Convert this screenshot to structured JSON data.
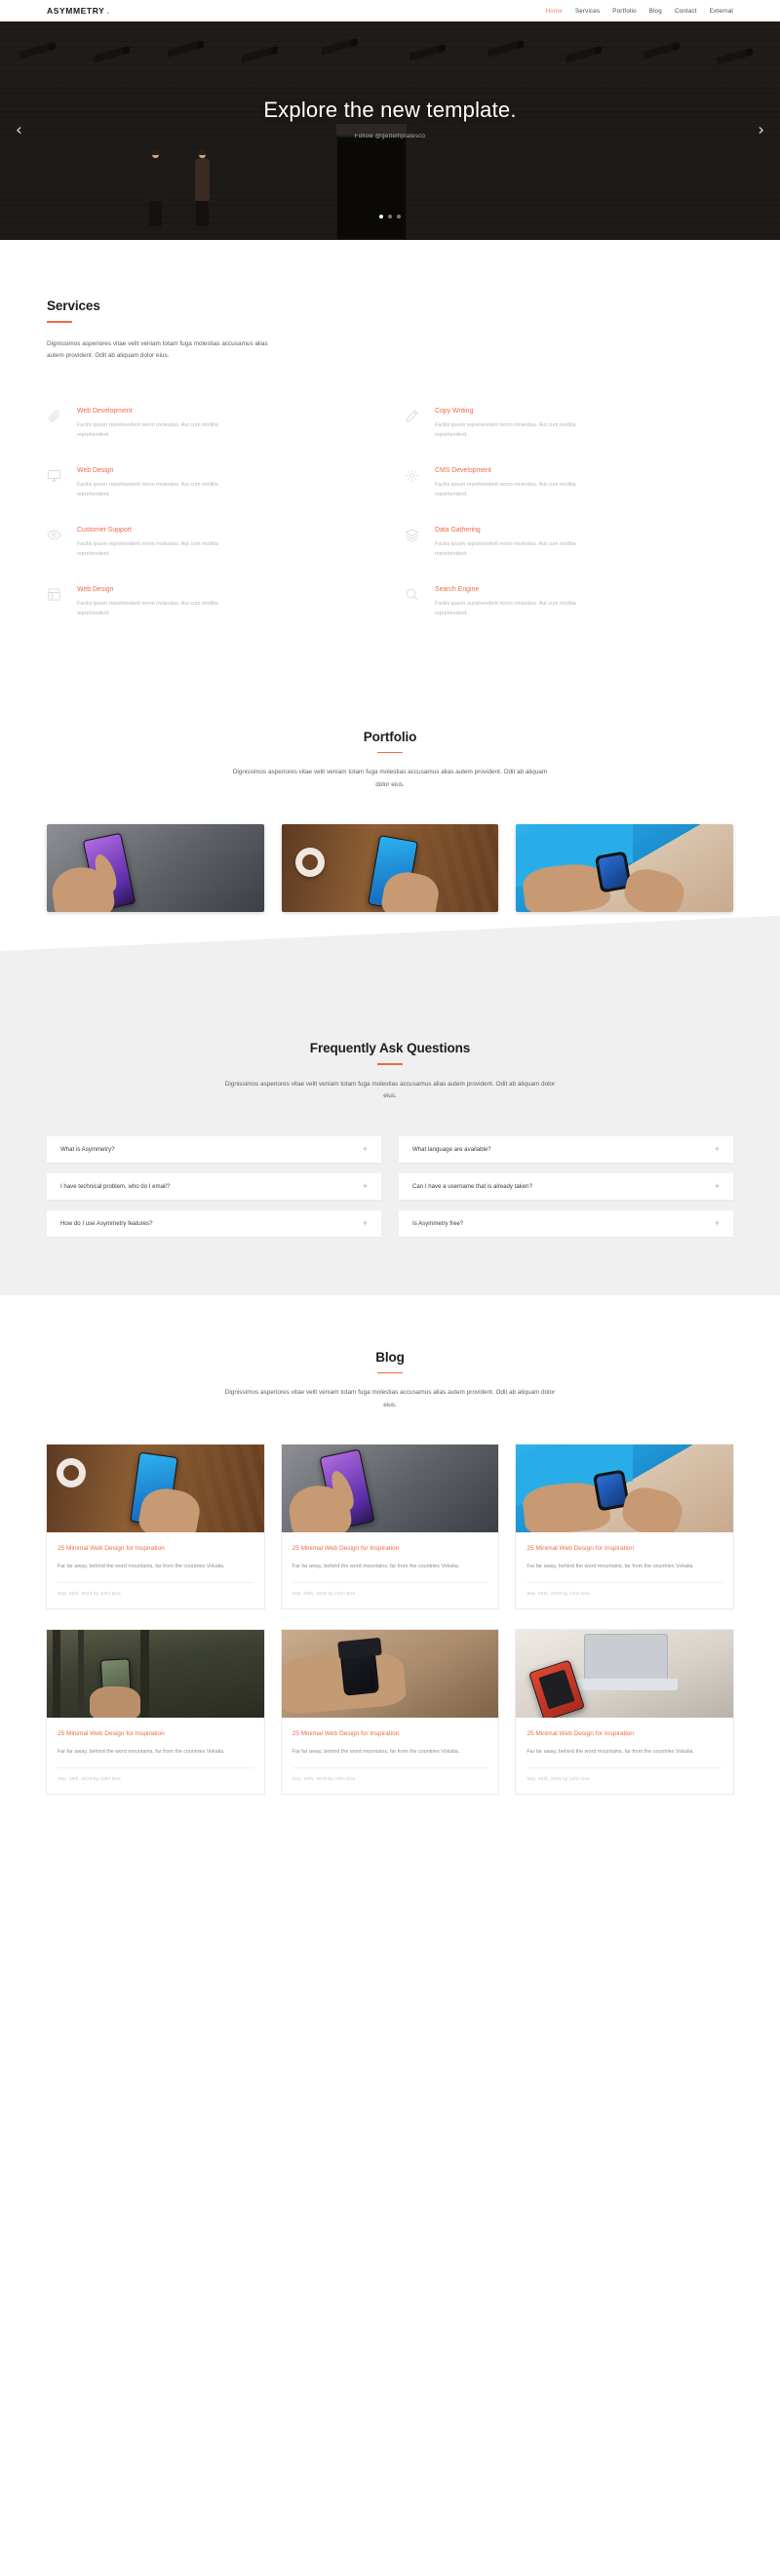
{
  "header": {
    "brand": "ASYMMETRY",
    "brand_dot": ".",
    "nav": [
      {
        "label": "Home",
        "active": true
      },
      {
        "label": "Services",
        "active": false
      },
      {
        "label": "Portfolio",
        "active": false
      },
      {
        "label": "Blog",
        "active": false
      },
      {
        "label": "Contact",
        "active": false
      },
      {
        "label": "External",
        "active": false
      }
    ]
  },
  "hero": {
    "title": "Explore the new template.",
    "subtitle": "Follow @gettemplatesco",
    "prev_icon": "‹",
    "next_icon": "›",
    "slides": 3,
    "active_slide": 1
  },
  "services": {
    "title": "Services",
    "description": "Dignissimos asperiores vitae velit veniam totam fuga molestias accusamus alias autem provident. Odit ab aliquam dolor eius.",
    "items": [
      {
        "icon": "paperclip-icon",
        "title": "Web Development",
        "desc": "Facilis ipsum reprehenderit nemo molestias. Aut cum mollitia reprehenderit."
      },
      {
        "icon": "pencil-icon",
        "title": "Copy Writing",
        "desc": "Facilis ipsum reprehenderit nemo molestias. Aut cum mollitia reprehenderit."
      },
      {
        "icon": "monitor-icon",
        "title": "Web Design",
        "desc": "Facilis ipsum reprehenderit nemo molestias. Aut cum mollitia reprehenderit."
      },
      {
        "icon": "gear-icon",
        "title": "CMS Development",
        "desc": "Facilis ipsum reprehenderit nemo molestias. Aut cum mollitia reprehenderit."
      },
      {
        "icon": "eye-icon",
        "title": "Customer Support",
        "desc": "Facilis ipsum reprehenderit nemo molestias. Aut cum mollitia reprehenderit."
      },
      {
        "icon": "layers-icon",
        "title": "Data Gathering",
        "desc": "Facilis ipsum reprehenderit nemo molestias. Aut cum mollitia reprehenderit."
      },
      {
        "icon": "layout-icon",
        "title": "Web Design",
        "desc": "Facilis ipsum reprehenderit nemo molestias. Aut cum mollitia reprehenderit."
      },
      {
        "icon": "search-icon",
        "title": "Search Engine",
        "desc": "Facilis ipsum reprehenderit nemo molestias. Aut cum mollitia reprehenderit."
      }
    ]
  },
  "portfolio": {
    "title": "Portfolio",
    "description": "Dignissimos asperiores vitae velit veniam totam fuga molestias accusamus alias autem provident. Odit ab aliquam dolor eius.",
    "items": [
      {
        "name": "portfolio-item-phone-purple"
      },
      {
        "name": "portfolio-item-phone-coffee"
      },
      {
        "name": "portfolio-item-smartwatch"
      }
    ]
  },
  "faq": {
    "title": "Frequently Ask Questions",
    "description": "Dignissimos asperiores vitae velit veniam totam fuga molestias accusamus alias autem provident. Odit ab aliquam dolor eius.",
    "plus_icon": "+",
    "items": [
      {
        "question": "What is Asymmetry?"
      },
      {
        "question": "What language are available?"
      },
      {
        "question": "I have technical problem, who do I email?"
      },
      {
        "question": "Can I have a username that is already taken?"
      },
      {
        "question": "How do I use Asymmetry features?"
      },
      {
        "question": "Is Asymmetry free?"
      }
    ]
  },
  "blog": {
    "title": "Blog",
    "description": "Dignissimos asperiores vitae velit veniam totam fuga molestias accusamus alias autem provident. Odit ab aliquam dolor eius.",
    "posts": [
      {
        "title": "25 Minimal Web Design for Inspiration",
        "excerpt": "Far far away, behind the word mountains, far from the countries Vokalia.",
        "meta": "Sep. 29th, 2019 by John Doe",
        "image": "phone-coffee"
      },
      {
        "title": "25 Minimal Web Design for Inspiration",
        "excerpt": "Far far away, behind the word mountains, far from the countries Vokalia.",
        "meta": "Sep. 29th, 2019 by John Doe",
        "image": "phone-purple"
      },
      {
        "title": "25 Minimal Web Design for Inspiration",
        "excerpt": "Far far away, behind the word mountains, far from the countries Vokalia.",
        "meta": "Sep. 29th, 2019 by John Doe",
        "image": "smartwatch"
      },
      {
        "title": "25 Minimal Web Design for Inspiration",
        "excerpt": "Far far away, behind the word mountains, far from the countries Vokalia.",
        "meta": "Sep. 29th, 2019 by John Doe",
        "image": "forest-phone"
      },
      {
        "title": "25 Minimal Web Design for Inspiration",
        "excerpt": "Far far away, behind the word mountains, far from the countries Vokalia.",
        "meta": "Sep. 29th, 2019 by John Doe",
        "image": "apple-watch"
      },
      {
        "title": "25 Minimal Web Design for Inspiration",
        "excerpt": "Far far away, behind the word mountains, far from the countries Vokalia.",
        "meta": "Sep. 29th, 2019 by John Doe",
        "image": "red-phone-laptop"
      }
    ]
  },
  "colors": {
    "accent": "#ef6a4a",
    "accent_rule": "#ee6a45",
    "faq_bg": "#f0f0f0",
    "text_dark": "#1d1d1d",
    "text_muted": "#b6b6b6"
  }
}
